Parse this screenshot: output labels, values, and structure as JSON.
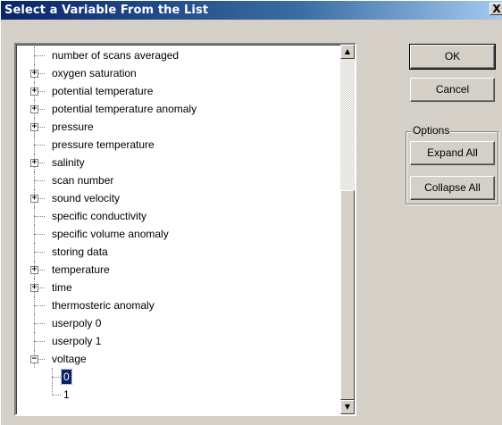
{
  "window": {
    "title": "Select a Variable From the List",
    "close_glyph": "X"
  },
  "tree": {
    "items": [
      {
        "label": "number of scans averaged",
        "expandable": false
      },
      {
        "label": "oxygen saturation",
        "expandable": true,
        "glyph": "+"
      },
      {
        "label": "potential temperature",
        "expandable": true,
        "glyph": "+"
      },
      {
        "label": "potential temperature anomaly",
        "expandable": true,
        "glyph": "+"
      },
      {
        "label": "pressure",
        "expandable": true,
        "glyph": "+"
      },
      {
        "label": "pressure temperature",
        "expandable": false
      },
      {
        "label": "salinity",
        "expandable": true,
        "glyph": "+"
      },
      {
        "label": "scan number",
        "expandable": false
      },
      {
        "label": "sound velocity",
        "expandable": true,
        "glyph": "+"
      },
      {
        "label": "specific conductivity",
        "expandable": false
      },
      {
        "label": "specific volume anomaly",
        "expandable": false
      },
      {
        "label": "storing data",
        "expandable": false
      },
      {
        "label": "temperature",
        "expandable": true,
        "glyph": "+"
      },
      {
        "label": "time",
        "expandable": true,
        "glyph": "+"
      },
      {
        "label": "thermosteric anomaly",
        "expandable": false
      },
      {
        "label": "userpoly 0",
        "expandable": false
      },
      {
        "label": "userpoly 1",
        "expandable": false
      },
      {
        "label": "voltage",
        "expandable": true,
        "expanded": true,
        "glyph": "−"
      }
    ],
    "children": [
      {
        "label": "0",
        "selected": true
      },
      {
        "label": "1",
        "selected": false
      }
    ],
    "scroll_up_glyph": "▲",
    "scroll_down_glyph": "▼"
  },
  "buttons": {
    "ok": "OK",
    "cancel": "Cancel",
    "options_label": "Options",
    "expand_all": "Expand All",
    "collapse_all": "Collapse All"
  },
  "colors": {
    "title_bar": "#0a246a",
    "selection": "#0a246a",
    "dialog_face": "#d4d0c8"
  }
}
